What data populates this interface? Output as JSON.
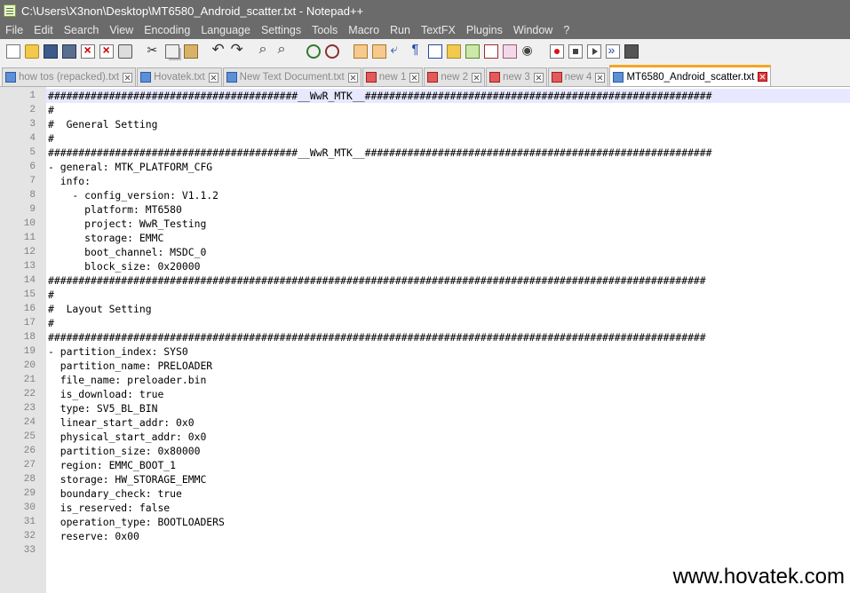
{
  "window": {
    "title": "C:\\Users\\X3non\\Desktop\\MT6580_Android_scatter.txt - Notepad++"
  },
  "menu": [
    "File",
    "Edit",
    "Search",
    "View",
    "Encoding",
    "Language",
    "Settings",
    "Tools",
    "Macro",
    "Run",
    "TextFX",
    "Plugins",
    "Window",
    "?"
  ],
  "toolbar": [
    {
      "name": "new-file-icon",
      "cls": "ic-doc"
    },
    {
      "name": "open-file-icon",
      "cls": "ic-folder"
    },
    {
      "name": "save-icon",
      "cls": "ic-disk"
    },
    {
      "name": "save-all-icon",
      "cls": "ic-disk2"
    },
    {
      "name": "close-icon",
      "cls": "ic-close"
    },
    {
      "name": "close-all-icon",
      "cls": "ic-close"
    },
    {
      "name": "print-icon",
      "cls": "ic-print"
    },
    {
      "name": "sep",
      "cls": "sep"
    },
    {
      "name": "cut-icon",
      "cls": "ic-cut"
    },
    {
      "name": "copy-icon",
      "cls": "ic-copy"
    },
    {
      "name": "paste-icon",
      "cls": "ic-paste"
    },
    {
      "name": "sep",
      "cls": "sep"
    },
    {
      "name": "undo-icon",
      "cls": "ic-undo"
    },
    {
      "name": "redo-icon",
      "cls": "ic-redo"
    },
    {
      "name": "sep",
      "cls": "sep"
    },
    {
      "name": "find-icon",
      "cls": "ic-find"
    },
    {
      "name": "replace-icon",
      "cls": "ic-find"
    },
    {
      "name": "sep",
      "cls": "sep"
    },
    {
      "name": "zoom-in-icon",
      "cls": "ic-zoom"
    },
    {
      "name": "zoom-out-icon",
      "cls": "ic-zoom2"
    },
    {
      "name": "sep",
      "cls": "sep"
    },
    {
      "name": "sync-vertical-icon",
      "cls": "ic-sync"
    },
    {
      "name": "sync-horizontal-icon",
      "cls": "ic-sync"
    },
    {
      "name": "word-wrap-icon",
      "cls": "ic-wrap"
    },
    {
      "name": "show-all-chars-icon",
      "cls": "ic-pilcrow"
    },
    {
      "name": "indent-guide-icon",
      "cls": "ic-indent"
    },
    {
      "name": "user-language-icon",
      "cls": "ic-lang"
    },
    {
      "name": "document-map-icon",
      "cls": "ic-map"
    },
    {
      "name": "function-list-icon",
      "cls": "ic-func"
    },
    {
      "name": "folder-workspace-icon",
      "cls": "ic-fold"
    },
    {
      "name": "monitoring-icon",
      "cls": "ic-eye"
    },
    {
      "name": "sep",
      "cls": "sep"
    },
    {
      "name": "record-macro-icon",
      "cls": "ic-rec"
    },
    {
      "name": "stop-macro-icon",
      "cls": "ic-stop"
    },
    {
      "name": "play-macro-icon",
      "cls": "ic-play"
    },
    {
      "name": "run-macro-multiple-icon",
      "cls": "ic-ffwd"
    },
    {
      "name": "save-macro-icon",
      "cls": "ic-savemacro"
    }
  ],
  "tabs": [
    {
      "label": "how tos (repacked).txt",
      "state": "saved",
      "active": false
    },
    {
      "label": "Hovatek.txt",
      "state": "saved",
      "active": false
    },
    {
      "label": "New Text Document.txt",
      "state": "saved",
      "active": false
    },
    {
      "label": "new 1",
      "state": "unsaved",
      "active": false
    },
    {
      "label": "new 2",
      "state": "unsaved",
      "active": false
    },
    {
      "label": "new 3",
      "state": "unsaved",
      "active": false
    },
    {
      "label": "new 4",
      "state": "unsaved",
      "active": false
    },
    {
      "label": "MT6580_Android_scatter.txt",
      "state": "saved",
      "active": true
    }
  ],
  "editor": {
    "lines": [
      "#########################################__WwR_MTK__#########################################################",
      "#",
      "#  General Setting",
      "#",
      "#########################################__WwR_MTK__#########################################################",
      "- general: MTK_PLATFORM_CFG",
      "  info:",
      "    - config_version: V1.1.2",
      "      platform: MT6580",
      "      project: WwR_Testing",
      "      storage: EMMC",
      "      boot_channel: MSDC_0",
      "      block_size: 0x20000",
      "############################################################################################################",
      "#",
      "#  Layout Setting",
      "#",
      "############################################################################################################",
      "- partition_index: SYS0",
      "  partition_name: PRELOADER",
      "  file_name: preloader.bin",
      "  is_download: true",
      "  type: SV5_BL_BIN",
      "  linear_start_addr: 0x0",
      "  physical_start_addr: 0x0",
      "  partition_size: 0x80000",
      "  region: EMMC_BOOT_1",
      "  storage: HW_STORAGE_EMMC",
      "  boundary_check: true",
      "  is_reserved: false",
      "  operation_type: BOOTLOADERS",
      "  reserve: 0x00",
      ""
    ]
  },
  "watermark": "www.hovatek.com"
}
